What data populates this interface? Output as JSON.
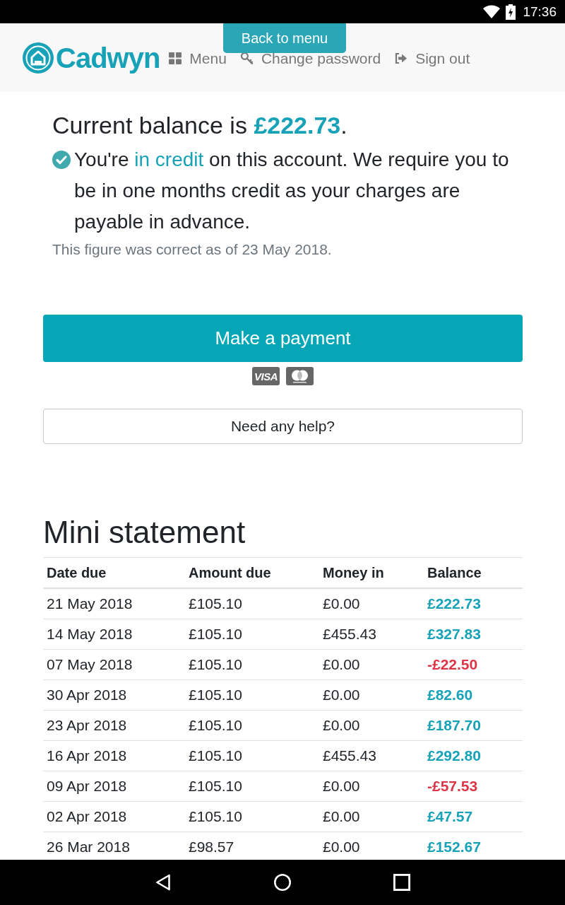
{
  "status_bar": {
    "time": "17:36"
  },
  "header": {
    "brand": "Cadwyn",
    "back_link": "Back to menu",
    "nav": [
      {
        "kind": "menu",
        "label": "Menu"
      },
      {
        "kind": "password",
        "label": "Change password"
      },
      {
        "kind": "signout",
        "label": "Sign out"
      }
    ]
  },
  "balance": {
    "parts": [
      {
        "text": "Current balance is ",
        "emphasis": false
      },
      {
        "text": "£222.73",
        "emphasis": true
      },
      {
        "text": ".",
        "emphasis": false
      }
    ],
    "status_parts": [
      {
        "text": "You're ",
        "highlight": false
      },
      {
        "text": "in credit",
        "highlight": true
      },
      {
        "text": " on this account. We require you to be in one months credit as your charges are payable in advance.",
        "highlight": false
      }
    ],
    "note": "This figure was correct as of 23 May 2018."
  },
  "payment": {
    "button": "Make a payment",
    "cards": [
      {
        "kind": "visa",
        "label": "VISA"
      },
      {
        "kind": "mastercard"
      }
    ],
    "help_button": "Need any help?"
  },
  "statement": {
    "title": "Mini statement",
    "columns": [
      "Date due",
      "Amount due",
      "Money in",
      "Balance"
    ],
    "rows": [
      {
        "date": "21 May 2018",
        "amount_due": "£105.10",
        "money_in": "£0.00",
        "balance": "£222.73",
        "color": "#17a2b8"
      },
      {
        "date": "14 May 2018",
        "amount_due": "£105.10",
        "money_in": "£455.43",
        "balance": "£327.83",
        "color": "#17a2b8"
      },
      {
        "date": "07 May 2018",
        "amount_due": "£105.10",
        "money_in": "£0.00",
        "balance": "-£22.50",
        "color": "#dc3545"
      },
      {
        "date": "30 Apr 2018",
        "amount_due": "£105.10",
        "money_in": "£0.00",
        "balance": "£82.60",
        "color": "#17a2b8"
      },
      {
        "date": "23 Apr 2018",
        "amount_due": "£105.10",
        "money_in": "£0.00",
        "balance": "£187.70",
        "color": "#17a2b8"
      },
      {
        "date": "16 Apr 2018",
        "amount_due": "£105.10",
        "money_in": "£455.43",
        "balance": "£292.80",
        "color": "#17a2b8"
      },
      {
        "date": "09 Apr 2018",
        "amount_due": "£105.10",
        "money_in": "£0.00",
        "balance": "-£57.53",
        "color": "#dc3545"
      },
      {
        "date": "02 Apr 2018",
        "amount_due": "£105.10",
        "money_in": "£0.00",
        "balance": "£47.57",
        "color": "#17a2b8"
      },
      {
        "date": "26 Mar 2018",
        "amount_due": "£98.57",
        "money_in": "£0.00",
        "balance": "£152.67",
        "color": "#17a2b8"
      }
    ]
  }
}
